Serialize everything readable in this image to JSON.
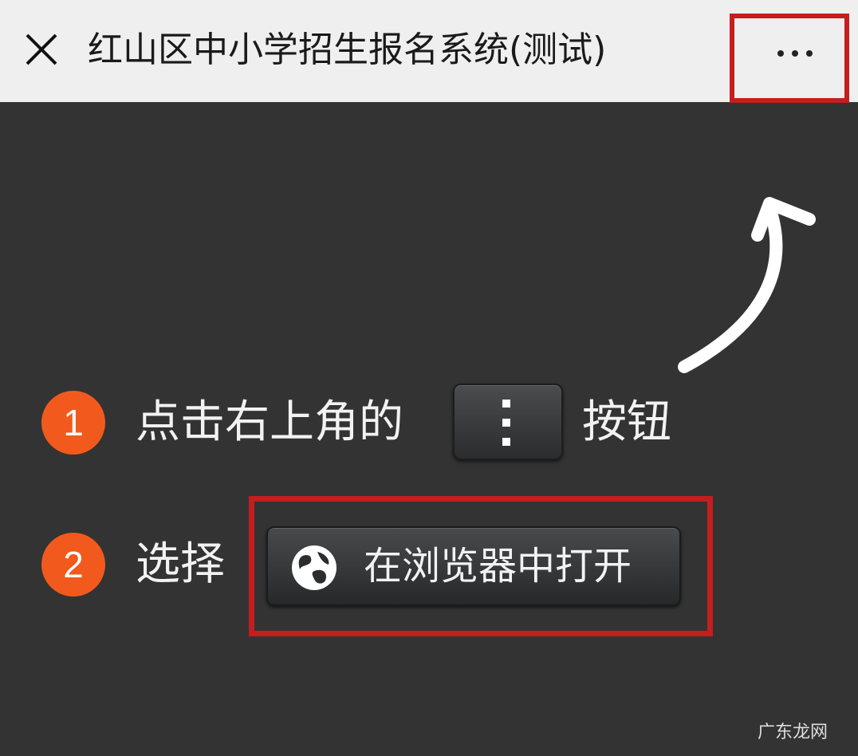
{
  "header": {
    "title": "红山区中小学招生报名系统(测试)"
  },
  "instructions": {
    "step1": {
      "number": "1",
      "text_before": "点击右上角的",
      "text_after": "按钮"
    },
    "step2": {
      "number": "2",
      "text": "选择",
      "button_label": "在浏览器中打开"
    }
  },
  "watermark": "广东龙网",
  "colors": {
    "header_bg": "#efefef",
    "body_bg": "#333333",
    "badge": "#f25a1d",
    "highlight": "#c41e1e"
  },
  "icons": {
    "close": "close-icon",
    "more": "more-dots-icon",
    "kebab": "kebab-icon",
    "globe": "globe-icon",
    "arrow": "curved-arrow-icon"
  }
}
